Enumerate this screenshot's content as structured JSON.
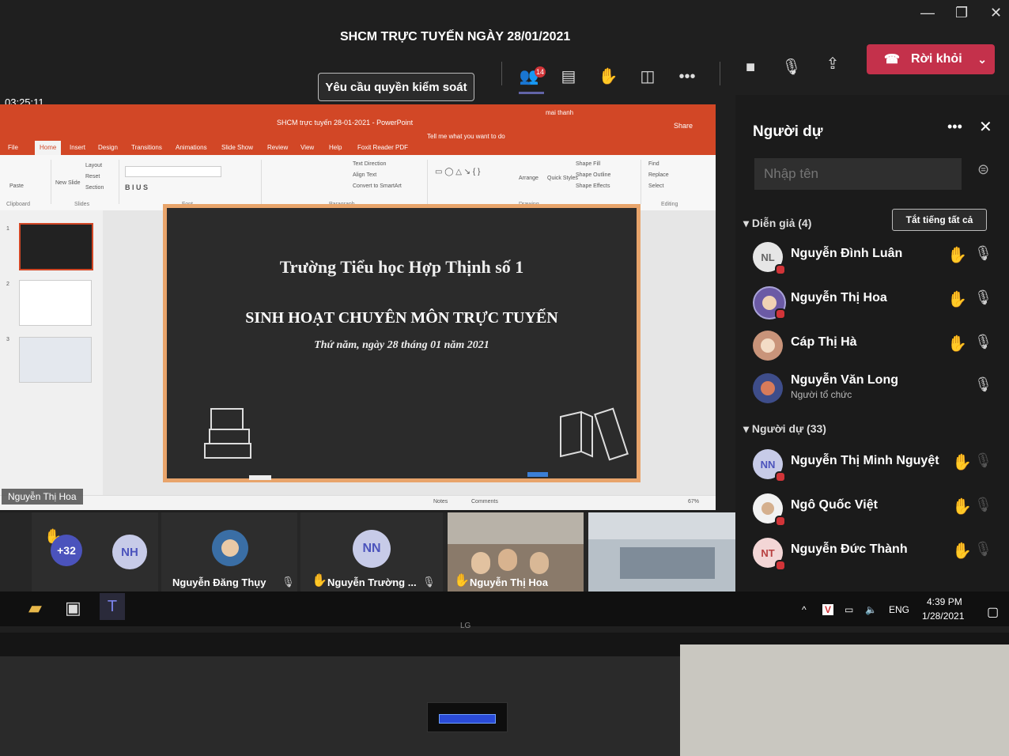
{
  "window": {
    "title": "SHCM TRỰC TUYẾN NGÀY 28/01/2021",
    "timer": "03:25:11",
    "request_control": "Yêu cầu quyền kiểm soát",
    "participants_badge": "14",
    "leave_label": "Rời khỏi"
  },
  "powerpoint": {
    "title": "SHCM trực tuyến 28-01-2021 - PowerPoint",
    "user": "mai thanh",
    "tell_me": "Tell me what you want to do",
    "share": "Share",
    "menu": [
      "File",
      "Home",
      "Insert",
      "Design",
      "Transitions",
      "Animations",
      "Slide Show",
      "Review",
      "View",
      "Help",
      "Foxit Reader PDF"
    ],
    "ribbon_groups": [
      "Clipboard",
      "Slides",
      "Font",
      "Paragraph",
      "Drawing",
      "Editing"
    ],
    "ribbon_items": [
      "Layout",
      "Reset",
      "Section",
      "New Slide",
      "Paste",
      "Arrange",
      "Quick Styles",
      "Shape Fill",
      "Shape Outline",
      "Shape Effects",
      "Find",
      "Replace",
      "Select",
      "Text Direction",
      "Align Text",
      "Convert to SmartArt"
    ],
    "status": [
      "Notes",
      "Comments",
      "67%"
    ],
    "slide": {
      "line1": "Trường Tiểu học Hợp Thịnh số 1",
      "line2": "SINH HOẠT CHUYÊN MÔN TRỰC TUYẾN",
      "line3": "Thứ năm, ngày 28 tháng 01 năm 2021"
    },
    "presenter_label": "Nguyễn Thị Hoa"
  },
  "video_strip": {
    "overflow": "+32",
    "tiles": [
      {
        "initials": "NH",
        "name": ""
      },
      {
        "initials": "",
        "name": "Nguyễn Đăng Thụy"
      },
      {
        "initials": "NN",
        "name": "Nguyễn Trường ..."
      },
      {
        "initials": "",
        "name": "Nguyễn Thị Hoa"
      },
      {
        "initials": "",
        "name": ""
      }
    ]
  },
  "people_pane": {
    "title": "Người dự",
    "search_placeholder": "Nhập tên",
    "presenters_header": "Diễn giả (4)",
    "mute_all": "Tắt tiếng tất cả",
    "presenters": [
      {
        "initials": "NL",
        "name": "Nguyễn Đình Luân",
        "sub": ""
      },
      {
        "initials": "",
        "name": "Nguyễn Thị Hoa",
        "sub": ""
      },
      {
        "initials": "",
        "name": "Cáp Thị Hà",
        "sub": ""
      },
      {
        "initials": "",
        "name": "Nguyễn Văn Long",
        "sub": "Người tổ chức"
      }
    ],
    "attendees_header": "Người dự (33)",
    "attendees": [
      {
        "initials": "NN",
        "name": "Nguyễn Thị Minh Nguyệt"
      },
      {
        "initials": "",
        "name": "Ngô Quốc Việt"
      },
      {
        "initials": "NT",
        "name": "Nguyễn Đức Thành"
      }
    ]
  },
  "taskbar": {
    "language": "ENG",
    "time": "4:39 PM",
    "date": "1/28/2021"
  },
  "colors": {
    "leave": "#c4314b",
    "ppt_accent": "#d24726",
    "teams_accent": "#6264a7",
    "slide_border": "#e8a46b"
  }
}
